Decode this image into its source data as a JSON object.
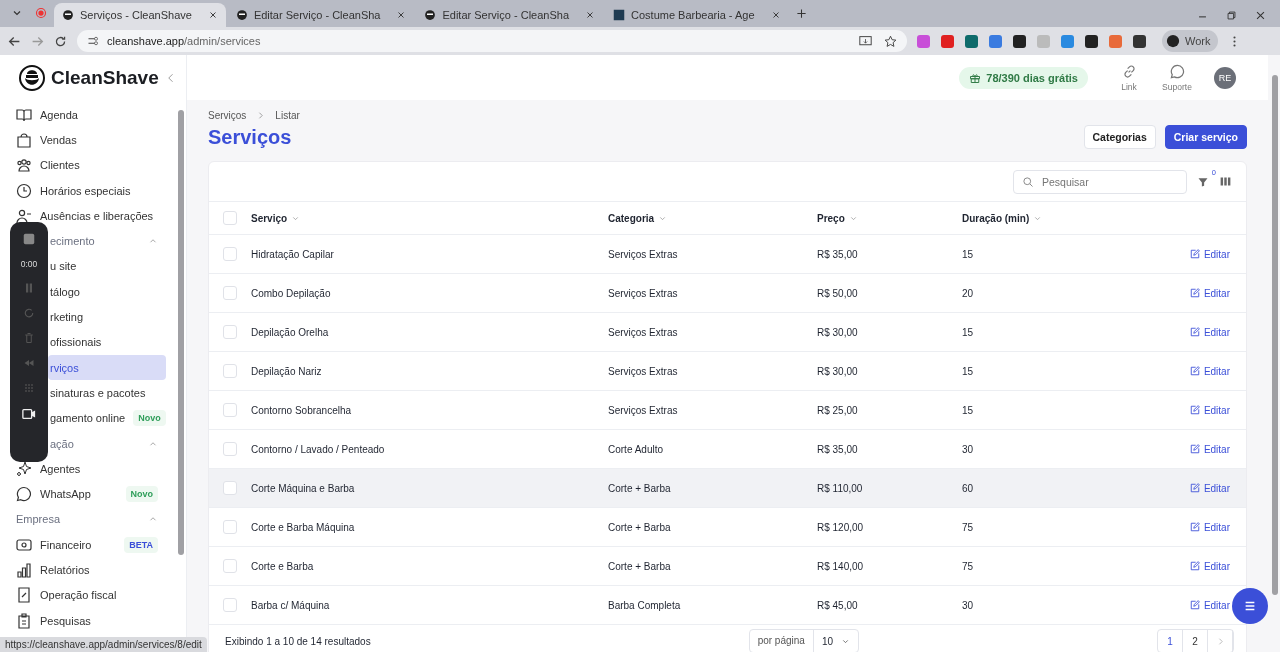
{
  "browser": {
    "tabs": [
      {
        "title": "Serviços - CleanShave",
        "selected": true
      },
      {
        "title": "Editar Serviço - CleanSha",
        "selected": false
      },
      {
        "title": "Editar Serviço - CleanSha",
        "selected": false
      },
      {
        "title": "Costume Barbearia - Age",
        "selected": false
      }
    ],
    "url_host": "cleanshave.app",
    "url_path": "/admin/services",
    "profile": "Work",
    "status_url": "https://cleanshave.app/admin/services/8/edit"
  },
  "header": {
    "brand": "CleanShave",
    "trial": "78/390 dias grátis",
    "links": [
      {
        "label": "Link"
      },
      {
        "label": "Suporte"
      }
    ],
    "avatar": "RE"
  },
  "recorder": {
    "timer": "0:00"
  },
  "sidebar": {
    "items": [
      {
        "kind": "link",
        "label": "Agenda",
        "selected": false
      },
      {
        "kind": "link",
        "label": "Vendas",
        "selected": false
      },
      {
        "kind": "link",
        "label": "Clientes",
        "selected": false
      },
      {
        "kind": "link",
        "label": "Horários especiais",
        "selected": false
      },
      {
        "kind": "link",
        "label": "Ausências e liberações",
        "selected": false
      },
      {
        "kind": "section",
        "label": "ecimento",
        "expanded": true
      },
      {
        "kind": "partial",
        "label": "u site",
        "selected": false
      },
      {
        "kind": "partial",
        "label": "tálogo",
        "selected": false
      },
      {
        "kind": "partial",
        "label": "rketing",
        "selected": false
      },
      {
        "kind": "partial",
        "label": "ofissionais",
        "selected": false
      },
      {
        "kind": "partial",
        "label": "rviços",
        "selected": true
      },
      {
        "kind": "partial",
        "label": "sinaturas e pacotes",
        "selected": false
      },
      {
        "kind": "partial",
        "label": "gamento online",
        "selected": false,
        "badge": {
          "text": "Novo",
          "color": "#2f9e5a"
        }
      },
      {
        "kind": "section",
        "label": "ação",
        "expanded": true
      },
      {
        "kind": "link",
        "label": "Agentes",
        "selected": false
      },
      {
        "kind": "link",
        "label": "WhatsApp",
        "selected": false,
        "badge": {
          "text": "Novo",
          "color": "#2f9e5a"
        }
      },
      {
        "kind": "section",
        "label": "Empresa",
        "expanded": true
      },
      {
        "kind": "link",
        "label": "Financeiro",
        "selected": false,
        "badge": {
          "text": "BETA",
          "color": "#3b4fd8"
        }
      },
      {
        "kind": "link",
        "label": "Relatórios",
        "selected": false
      },
      {
        "kind": "link",
        "label": "Operação fiscal",
        "selected": false
      },
      {
        "kind": "link",
        "label": "Pesquisas",
        "selected": false
      }
    ]
  },
  "main": {
    "breadcrumb": [
      "Serviços",
      "Listar"
    ],
    "title": "Serviços",
    "buttons": [
      {
        "label": "Categorias",
        "kind": "secondary"
      },
      {
        "label": "Criar serviço",
        "kind": "primary"
      }
    ],
    "search": {
      "placeholder": "Pesquisar"
    },
    "filter_count": "0",
    "table": {
      "all_checked": false,
      "columns": [
        "Serviço",
        "Categoria",
        "Preço",
        "Duração (min)"
      ],
      "rows": [
        {
          "service": "Hidratação Capilar",
          "category": "Serviços Extras",
          "price": "R$ 35,00",
          "duration": "15",
          "action": "Editar",
          "checked": false,
          "hovered": false
        },
        {
          "service": "Combo Depilação",
          "category": "Serviços Extras",
          "price": "R$ 50,00",
          "duration": "20",
          "action": "Editar",
          "checked": false,
          "hovered": false
        },
        {
          "service": "Depilação Orelha",
          "category": "Serviços Extras",
          "price": "R$ 30,00",
          "duration": "15",
          "action": "Editar",
          "checked": false,
          "hovered": false
        },
        {
          "service": "Depilação Nariz",
          "category": "Serviços Extras",
          "price": "R$ 30,00",
          "duration": "15",
          "action": "Editar",
          "checked": false,
          "hovered": false
        },
        {
          "service": "Contorno Sobrancelha",
          "category": "Serviços Extras",
          "price": "R$ 25,00",
          "duration": "15",
          "action": "Editar",
          "checked": false,
          "hovered": false
        },
        {
          "service": "Contorno / Lavado / Penteado",
          "category": "Corte Adulto",
          "price": "R$ 35,00",
          "duration": "30",
          "action": "Editar",
          "checked": false,
          "hovered": false
        },
        {
          "service": "Corte Máquina e Barba",
          "category": "Corte + Barba",
          "price": "R$ 110,00",
          "duration": "60",
          "action": "Editar",
          "checked": false,
          "hovered": true
        },
        {
          "service": "Corte e Barba Máquina",
          "category": "Corte + Barba",
          "price": "R$ 120,00",
          "duration": "75",
          "action": "Editar",
          "checked": false,
          "hovered": false
        },
        {
          "service": "Corte e Barba",
          "category": "Corte + Barba",
          "price": "R$ 140,00",
          "duration": "75",
          "action": "Editar",
          "checked": false,
          "hovered": false
        },
        {
          "service": "Barba c/ Máquina",
          "category": "Barba Completa",
          "price": "R$ 45,00",
          "duration": "30",
          "action": "Editar",
          "checked": false,
          "hovered": false
        }
      ]
    },
    "footer": {
      "summary": "Exibindo 1 a 10 de 14 resultados",
      "per_page_label": "por página",
      "per_page": "10",
      "pages": [
        {
          "label": "1",
          "selected": true
        },
        {
          "label": "2",
          "selected": false
        }
      ]
    }
  }
}
